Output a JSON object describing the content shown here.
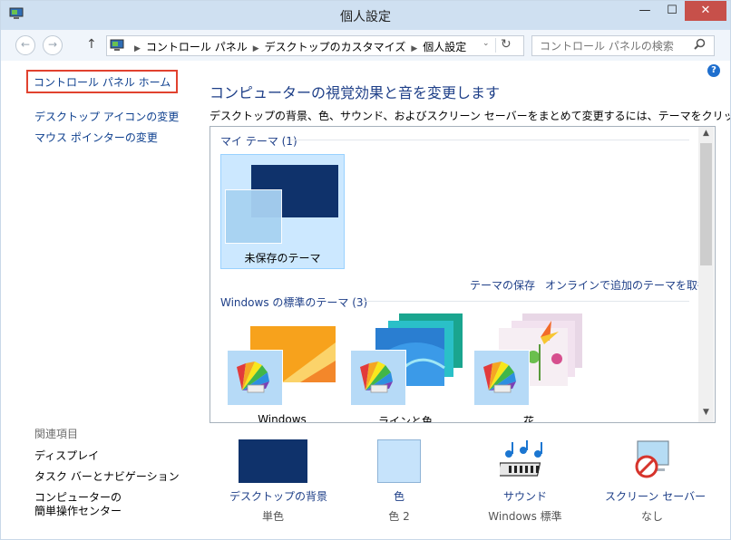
{
  "window": {
    "title": "個人設定",
    "controls": {
      "minimize": "—",
      "maximize": "☐",
      "close": "✕"
    }
  },
  "address": {
    "breadcrumbs": [
      "コントロール パネル",
      "デスクトップのカスタマイズ",
      "個人設定"
    ],
    "search_placeholder": "コントロール パネルの検索"
  },
  "sidebar": {
    "home": "コントロール パネル ホーム",
    "links": [
      "デスクトップ アイコンの変更",
      "マウス ポインターの変更"
    ],
    "related_header": "関連項目",
    "related": [
      "ディスプレイ",
      "タスク バーとナビゲーション",
      "コンピューターの",
      "簡単操作センター"
    ]
  },
  "main": {
    "heading": "コンピューターの視覚効果と音を変更します",
    "description": "デスクトップの背景、色、サウンド、およびスクリーン セーバーをまとめて変更するには、テーマをクリックします。",
    "my_themes_header": "マイ テーマ (1)",
    "my_theme": {
      "name": "未保存のテーマ",
      "accent": "#0f326b",
      "selected_bg": "#cce8ff"
    },
    "save_theme": "テーマの保存",
    "more_online": "オンラインで追加のテーマを取得",
    "default_themes_header": "Windows の標準のテーマ (3)",
    "default_themes": [
      {
        "name": "Windows"
      },
      {
        "name": "ラインと色"
      },
      {
        "name": "花"
      }
    ]
  },
  "bottom": [
    {
      "label": "デスクトップの背景",
      "value": "単色",
      "swatch": "#0f326b"
    },
    {
      "label": "色",
      "value": "色 2",
      "swatch": "#c6e3fb"
    },
    {
      "label": "サウンド",
      "value": "Windows 標準"
    },
    {
      "label": "スクリーン セーバー",
      "value": "なし"
    }
  ],
  "icons": {
    "back": "←",
    "forward": "→",
    "up": "↑",
    "dropdown": "⌄",
    "refresh": "↻",
    "search": "⚲",
    "help": "?",
    "scroll_up": "▲",
    "scroll_down": "▼",
    "crumb_sep": "▶"
  }
}
